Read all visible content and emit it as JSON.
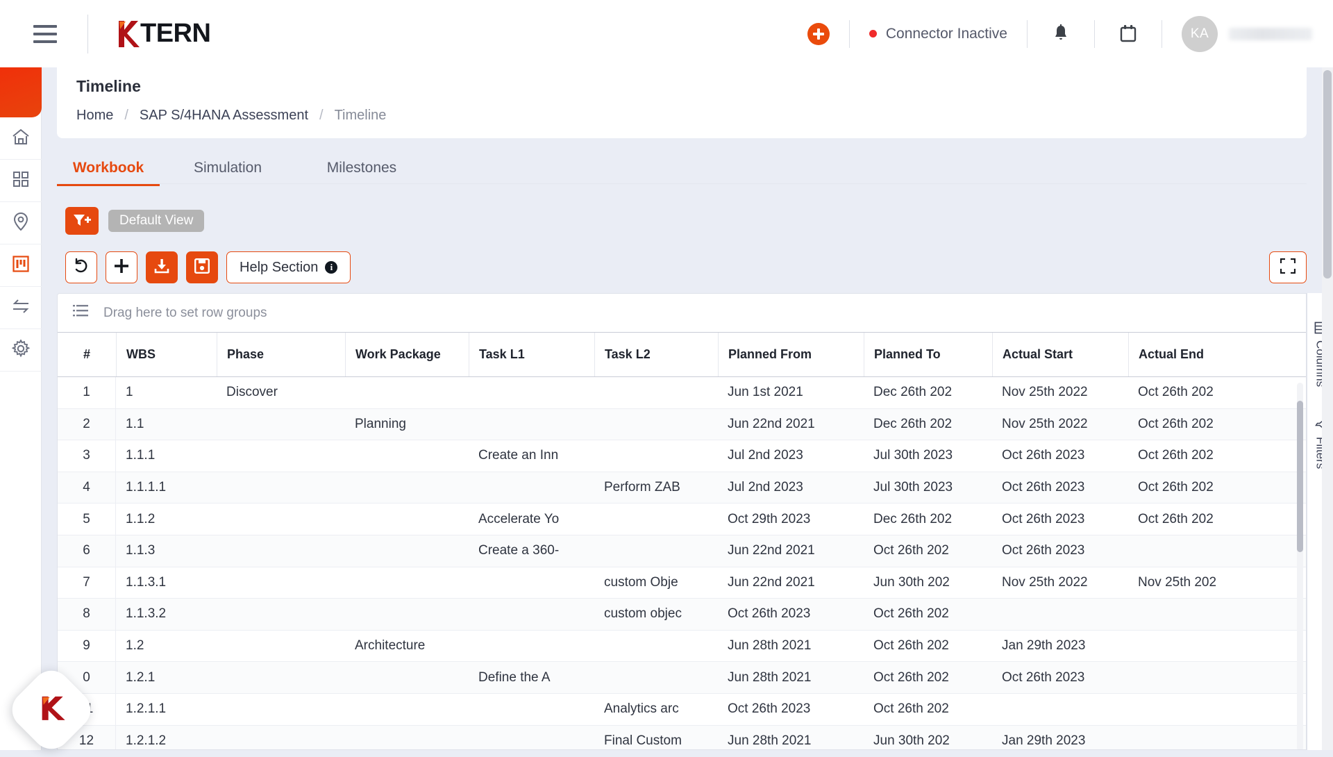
{
  "topbar": {
    "menu_icon": "hamburger-icon",
    "logo_text": "TERN",
    "logo_mark": "k-logo-icon",
    "add_icon": "plus-circle-icon",
    "connector_status": "Connector Inactive",
    "connector_dot_color": "#f02b2b",
    "bell_icon": "bell-icon",
    "calendar_icon": "calendar-icon",
    "avatar_initials": "KA",
    "user_name": ""
  },
  "rail": {
    "items": [
      {
        "icon": "home-icon",
        "name": "home"
      },
      {
        "icon": "grid-icon",
        "name": "dashboard"
      },
      {
        "icon": "location-pin-icon",
        "name": "location"
      },
      {
        "icon": "project-board-icon",
        "name": "projects",
        "active": true
      },
      {
        "icon": "transfer-icon",
        "name": "transfer"
      },
      {
        "icon": "gear-icon",
        "name": "settings"
      }
    ]
  },
  "header": {
    "title": "Timeline",
    "breadcrumb": [
      "Home",
      "SAP S/4HANA Assessment",
      "Timeline"
    ],
    "separator": "/"
  },
  "tabs": [
    {
      "label": "Workbook",
      "active": true
    },
    {
      "label": "Simulation",
      "active": false
    },
    {
      "label": "Milestones",
      "active": false
    }
  ],
  "toolbar": {
    "filter_add_icon": "filter-plus-icon",
    "view_chip": "Default View",
    "refresh_icon": "undo-icon",
    "add_icon": "plus-icon",
    "download_icon": "download-icon",
    "save_icon": "floppy-save-icon",
    "help_label": "Help Section",
    "help_info_icon": "info-icon",
    "expand_icon": "fullscreen-icon"
  },
  "grid": {
    "rowgroup_placeholder": "Drag here to set row groups",
    "rowgroup_icon": "row-group-icon",
    "columns": [
      "#",
      "WBS",
      "Phase",
      "Work Package",
      "Task L1",
      "Task L2",
      "Planned From",
      "Planned To",
      "Actual Start",
      "Actual End"
    ],
    "rows": [
      {
        "idx": "1",
        "wbs": "1",
        "phase": "Discover",
        "wp": "",
        "t1": "",
        "t2": "",
        "pf": "Jun 1st 2021",
        "pt": "Dec 26th 202",
        "as": "Nov 25th 2022",
        "ae": "Oct 26th 202"
      },
      {
        "idx": "2",
        "wbs": "1.1",
        "phase": "",
        "wp": "Planning",
        "t1": "",
        "t2": "",
        "pf": "Jun 22nd 2021",
        "pt": "Dec 26th 202",
        "as": "Nov 25th 2022",
        "ae": "Oct 26th 202"
      },
      {
        "idx": "3",
        "wbs": "1.1.1",
        "phase": "",
        "wp": "",
        "t1": "Create an Inn",
        "t2": "",
        "pf": "Jul 2nd 2023",
        "pt": "Jul 30th 2023",
        "as": "Oct 26th 2023",
        "ae": "Oct 26th 202"
      },
      {
        "idx": "4",
        "wbs": "1.1.1.1",
        "phase": "",
        "wp": "",
        "t1": "",
        "t2": "Perform ZAB",
        "pf": "Jul 2nd 2023",
        "pt": "Jul 30th 2023",
        "as": "Oct 26th 2023",
        "ae": "Oct 26th 202"
      },
      {
        "idx": "5",
        "wbs": "1.1.2",
        "phase": "",
        "wp": "",
        "t1": "Accelerate Yo",
        "t2": "",
        "pf": "Oct 29th 2023",
        "pt": "Dec 26th 202",
        "as": "Oct 26th 2023",
        "ae": "Oct 26th 202"
      },
      {
        "idx": "6",
        "wbs": "1.1.3",
        "phase": "",
        "wp": "",
        "t1": "Create a 360-",
        "t2": "",
        "pf": "Jun 22nd 2021",
        "pt": "Oct 26th 202",
        "as": "Oct 26th 2023",
        "ae": ""
      },
      {
        "idx": "7",
        "wbs": "1.1.3.1",
        "phase": "",
        "wp": "",
        "t1": "",
        "t2": "custom Obje",
        "pf": "Jun 22nd 2021",
        "pt": "Jun 30th 202",
        "as": "Nov 25th 2022",
        "ae": "Nov 25th 202"
      },
      {
        "idx": "8",
        "wbs": "1.1.3.2",
        "phase": "",
        "wp": "",
        "t1": "",
        "t2": "custom objec",
        "pf": "Oct 26th 2023",
        "pt": "Oct 26th 202",
        "as": "",
        "ae": ""
      },
      {
        "idx": "9",
        "wbs": "1.2",
        "phase": "",
        "wp": "Architecture",
        "t1": "",
        "t2": "",
        "pf": "Jun 28th 2021",
        "pt": "Oct 26th 202",
        "as": "Jan 29th 2023",
        "ae": ""
      },
      {
        "idx": "0",
        "wbs": "1.2.1",
        "phase": "",
        "wp": "",
        "t1": "Define the A",
        "t2": "",
        "pf": "Jun 28th 2021",
        "pt": "Oct 26th 202",
        "as": "Oct 26th 2023",
        "ae": ""
      },
      {
        "idx": "11",
        "wbs": "1.2.1.1",
        "phase": "",
        "wp": "",
        "t1": "",
        "t2": "Analytics arc",
        "pf": "Oct 26th 2023",
        "pt": "Oct 26th 202",
        "as": "",
        "ae": ""
      },
      {
        "idx": "12",
        "wbs": "1.2.1.2",
        "phase": "",
        "wp": "",
        "t1": "",
        "t2": "Final Custom",
        "pf": "Jun 28th 2021",
        "pt": "Jun 30th 202",
        "as": "Jan 29th 2023",
        "ae": ""
      }
    ]
  },
  "side_panel": {
    "columns_label": "Columns",
    "columns_icon": "columns-icon",
    "filters_label": "Filters",
    "filters_icon": "funnel-icon"
  },
  "fab": {
    "icon": "ktern-assistant-icon"
  },
  "colors": {
    "accent": "#e6490f",
    "accent_bright": "#f0300a",
    "status_red": "#f02b2b",
    "page_bg": "#eaedf5",
    "text": "#3c4257"
  }
}
